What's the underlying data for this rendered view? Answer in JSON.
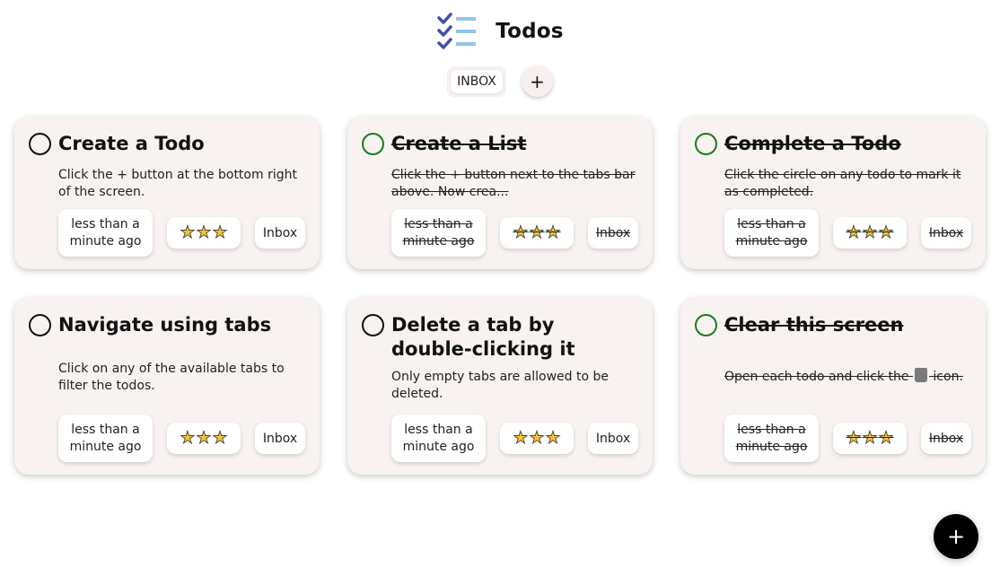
{
  "header": {
    "title": "Todos",
    "logo_icon": "checklist-icon"
  },
  "tabs": {
    "items": [
      {
        "label": "INBOX"
      }
    ],
    "add_label": "+"
  },
  "todos": [
    {
      "title": "Create a Todo",
      "description": "Click the + button at the bottom right of the screen.",
      "completed": false,
      "time": "less than a minute ago",
      "priority_stars": 3,
      "tab": "Inbox"
    },
    {
      "title": "Create a List",
      "description": "Click the + button next to the tabs bar above. Now crea...",
      "completed": true,
      "time": "less than a minute ago",
      "priority_stars": 3,
      "tab": "Inbox"
    },
    {
      "title": "Complete a Todo",
      "description": "Click the circle on any todo to mark it as completed.",
      "completed": true,
      "time": "less than a minute ago",
      "priority_stars": 3,
      "tab": "Inbox"
    },
    {
      "title": "Navigate using tabs",
      "description": "Click on any of the available tabs to filter the todos.",
      "completed": false,
      "time": "less than a minute ago",
      "priority_stars": 3,
      "tab": "Inbox"
    },
    {
      "title": "Delete a tab by double-clicking it",
      "description": "Only empty tabs are allowed to be deleted.",
      "completed": false,
      "time": "less than a minute ago",
      "priority_stars": 3,
      "tab": "Inbox"
    },
    {
      "title": "Clear this screen",
      "description_before": "Open each todo and click the",
      "description_icon": "trash-icon",
      "description_after": "icon.",
      "completed": true,
      "time": "less than a minute ago",
      "priority_stars": 3,
      "tab": "Inbox"
    }
  ],
  "star_glyph": "★",
  "fab": {
    "label": "+"
  },
  "colors": {
    "card_bg": "#f8f2f1",
    "completed_check": "#1a7d1a",
    "star": "#f5c330",
    "fab": "#000000"
  }
}
